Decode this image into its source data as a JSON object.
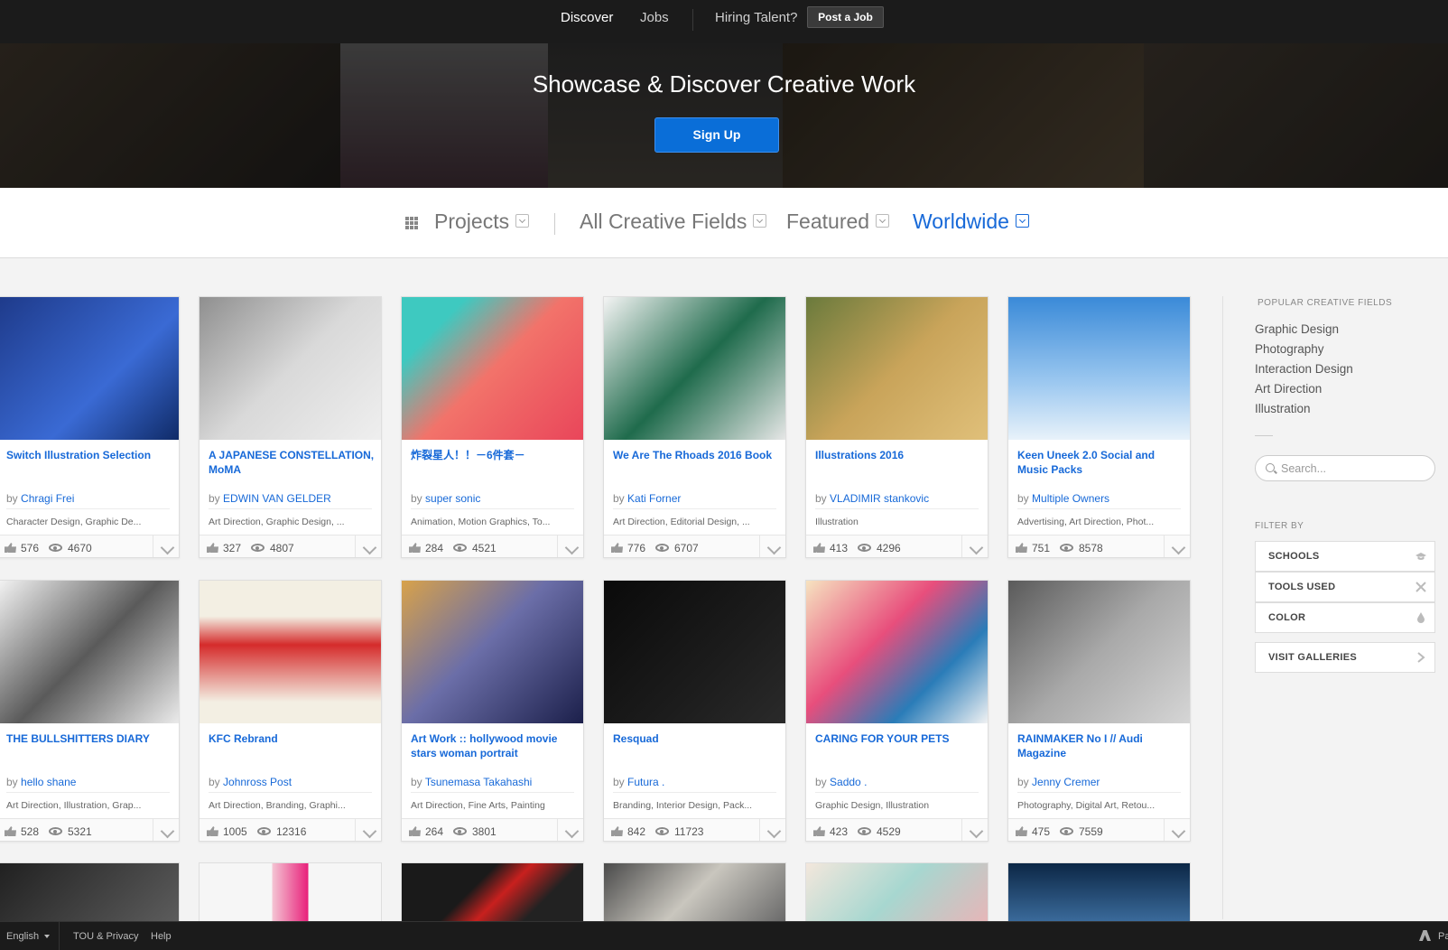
{
  "topnav": {
    "discover": "Discover",
    "jobs": "Jobs",
    "hiring": "Hiring Talent?",
    "post_job": "Post a Job"
  },
  "hero": {
    "title": "Showcase & Discover Creative Work",
    "signup": "Sign Up"
  },
  "filterbar": {
    "projects": "Projects",
    "fields": "All Creative Fields",
    "featured": "Featured",
    "location": "Worldwide",
    "accent": "#1769d8"
  },
  "cards": [
    {
      "title": "Switch Illustration Selection",
      "by": "by",
      "owner": "Chragi Frei",
      "fields": "Character Design, Graphic De...",
      "appreciations": "576",
      "views": "4670"
    },
    {
      "title": "A JAPANESE CONSTELLATION, MoMA",
      "by": "by",
      "owner": "EDWIN VAN GELDER",
      "fields": "Art Direction, Graphic Design, ...",
      "appreciations": "327",
      "views": "4807"
    },
    {
      "title": "炸裂星人！！－6件套－",
      "by": "by",
      "owner": "super sonic",
      "fields": "Animation, Motion Graphics, To...",
      "appreciations": "284",
      "views": "4521"
    },
    {
      "title": "We Are The Rhoads 2016 Book",
      "by": "by",
      "owner": "Kati Forner",
      "fields": "Art Direction, Editorial Design, ...",
      "appreciations": "776",
      "views": "6707"
    },
    {
      "title": "Illustrations 2016",
      "by": "by",
      "owner": "VLADIMIR stankovic",
      "fields": "Illustration",
      "appreciations": "413",
      "views": "4296"
    },
    {
      "title": "Keen Uneek 2.0 Social and Music Packs",
      "by": "by",
      "owner": "Multiple Owners",
      "fields": "Advertising, Art Direction, Phot...",
      "appreciations": "751",
      "views": "8578"
    },
    {
      "title": "THE BULLSHITTERS DIARY",
      "by": "by",
      "owner": "hello shane",
      "fields": "Art Direction, Illustration, Grap...",
      "appreciations": "528",
      "views": "5321"
    },
    {
      "title": "KFC Rebrand",
      "by": "by",
      "owner": "Johnross Post",
      "fields": "Art Direction, Branding, Graphi...",
      "appreciations": "1005",
      "views": "12316"
    },
    {
      "title": "Art Work :: hollywood movie stars woman portrait",
      "by": "by",
      "owner": "Tsunemasa Takahashi",
      "fields": "Art Direction, Fine Arts, Painting",
      "appreciations": "264",
      "views": "3801"
    },
    {
      "title": "Resquad",
      "by": "by",
      "owner": "Futura .",
      "fields": "Branding, Interior Design, Pack...",
      "appreciations": "842",
      "views": "11723"
    },
    {
      "title": "CARING FOR YOUR PETS",
      "by": "by",
      "owner": "Saddo .",
      "fields": "Graphic Design, Illustration",
      "appreciations": "423",
      "views": "4529"
    },
    {
      "title": "RAINMAKER No I // Audi Magazine",
      "by": "by",
      "owner": "Jenny Cremer",
      "fields": "Photography, Digital Art, Retou...",
      "appreciations": "475",
      "views": "7559"
    }
  ],
  "sidebar": {
    "popular_heading": "POPULAR CREATIVE FIELDS",
    "fields": [
      "Graphic Design",
      "Photography",
      "Interaction Design",
      "Art Direction",
      "Illustration"
    ],
    "search_placeholder": "Search...",
    "filter_by": "FILTER BY",
    "schools": "SCHOOLS",
    "tools_used": "TOOLS USED",
    "color": "COLOR",
    "visit_galleries": "VISIT GALLERIES"
  },
  "footer": {
    "language": "English",
    "tou": "TOU & Privacy",
    "help": "Help",
    "partial": "Pa"
  }
}
